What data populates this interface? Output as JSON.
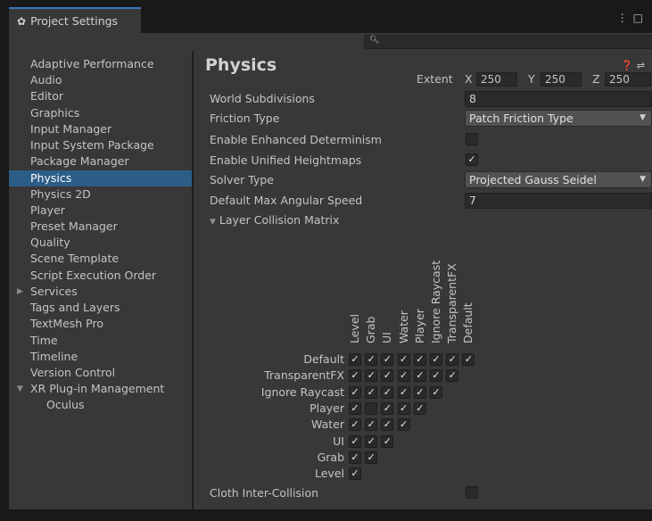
{
  "window": {
    "tab_title": "Project Settings",
    "icons": [
      "gear-icon",
      "kebab-menu-icon",
      "maximize-icon"
    ]
  },
  "search": {
    "placeholder": "",
    "icon": "search-icon"
  },
  "sidebar": {
    "items": [
      {
        "label": "Adaptive Performance"
      },
      {
        "label": "Audio"
      },
      {
        "label": "Editor"
      },
      {
        "label": "Graphics"
      },
      {
        "label": "Input Manager"
      },
      {
        "label": "Input System Package"
      },
      {
        "label": "Package Manager"
      },
      {
        "label": "Physics",
        "selected": true
      },
      {
        "label": "Physics 2D"
      },
      {
        "label": "Player"
      },
      {
        "label": "Preset Manager"
      },
      {
        "label": "Quality"
      },
      {
        "label": "Scene Template"
      },
      {
        "label": "Script Execution Order"
      },
      {
        "label": "Services",
        "expandable": true,
        "expanded": false
      },
      {
        "label": "Tags and Layers"
      },
      {
        "label": "TextMesh Pro"
      },
      {
        "label": "Time"
      },
      {
        "label": "Timeline"
      },
      {
        "label": "Version Control"
      },
      {
        "label": "XR Plug-in Management",
        "expandable": true,
        "expanded": true
      },
      {
        "label": "Oculus",
        "child": true
      }
    ]
  },
  "main": {
    "title": "Physics",
    "header_icons": [
      "help-icon",
      "preset-icon"
    ],
    "extent": {
      "label": "Extent",
      "x_label": "X",
      "x": "250",
      "y_label": "Y",
      "y": "250",
      "z_label": "Z",
      "z": "250"
    },
    "world_subdivisions": {
      "label": "World Subdivisions",
      "value": "8"
    },
    "friction_type": {
      "label": "Friction Type",
      "value": "Patch Friction Type"
    },
    "enhanced_determinism": {
      "label": "Enable Enhanced Determinism",
      "checked": false
    },
    "unified_heightmaps": {
      "label": "Enable Unified Heightmaps",
      "checked": true
    },
    "solver_type": {
      "label": "Solver Type",
      "value": "Projected Gauss Seidel"
    },
    "max_angular_speed": {
      "label": "Default Max Angular Speed",
      "value": "7"
    },
    "layer_matrix": {
      "label": "Layer Collision Matrix",
      "expanded": true,
      "column_labels": [
        "Level",
        "Grab",
        "UI",
        "Water",
        "Player",
        "Ignore Raycast",
        "TransparentFX",
        "Default"
      ],
      "row_labels": [
        "Default",
        "TransparentFX",
        "Ignore Raycast",
        "Player",
        "Water",
        "UI",
        "Grab",
        "Level"
      ],
      "matrix": [
        [
          true,
          true,
          true,
          true,
          true,
          true,
          true,
          true
        ],
        [
          true,
          true,
          true,
          true,
          true,
          true,
          true
        ],
        [
          true,
          true,
          true,
          true,
          true,
          true
        ],
        [
          true,
          false,
          true,
          true,
          true
        ],
        [
          true,
          true,
          true,
          true
        ],
        [
          true,
          true,
          true
        ],
        [
          true,
          true
        ],
        [
          true
        ]
      ]
    },
    "cloth_inter_collision": {
      "label": "Cloth Inter-Collision",
      "checked": false
    }
  }
}
